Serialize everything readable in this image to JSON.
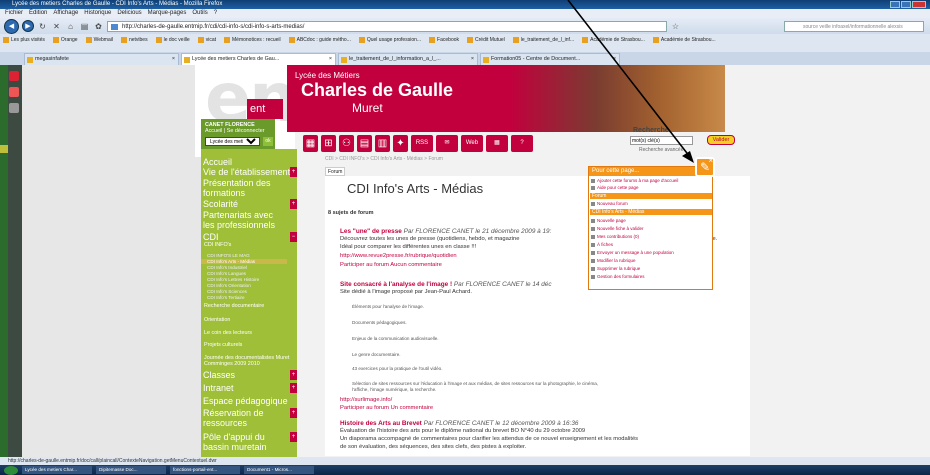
{
  "window": {
    "title": "Lycée des metiers Charles de Gaulle - CDI Info's Arts - Médias - Mozilla Firefox"
  },
  "menubar": [
    "Fichier",
    "Édition",
    "Affichage",
    "Historique",
    "Delicious",
    "Marque-pages",
    "Outils",
    "?"
  ],
  "url": "http://charles-de-gaulle.entmip.fr/cdi/cdi-info-s/cdi-info-s-arts-medias/",
  "search_placeholder": "source veille infoaxel/informationnelle alexsis",
  "bookmarks": [
    "Les plus visités",
    "Orange",
    "Webmail",
    "netvibes",
    "le doc veille",
    "vicat",
    "Mémonotices : recueil",
    "ABCdoc : guide métho...",
    "Quel usage profession...",
    "Facebook",
    "Crédit Mutuel",
    "le_traitement_de_l_inf...",
    "Académie de Strasbou...",
    "Académie de Strasbou..."
  ],
  "tabs": [
    {
      "label": "megasinfafete"
    },
    {
      "label": "Lycée des metiers Charles de Gau..."
    },
    {
      "label": "le_traitement_de_l_information_a_l_..."
    },
    {
      "label": "Formation05 - Centre de Document..."
    }
  ],
  "header": {
    "school_top": "Lycée des Métiers",
    "school": "Charles de Gaulle",
    "town": "Muret",
    "ent_tag": "ent",
    "ent_big": "ent"
  },
  "user": {
    "name": "CANET FLORENCE",
    "links": "Accueil | Se déconnecter",
    "select_value": "Lycée des metiers Charles",
    "ok": "ok"
  },
  "menu": {
    "accueil": "Accueil",
    "vie": "Vie de l'établissement",
    "presentation": "Présentation des formations",
    "scolarite": "Scolarité",
    "partenariats": "Partenariats avec les professionnels",
    "cdi": "CDI",
    "cdi_infos": "CDI INFO's",
    "subs": [
      "CDI INFO'S LE MAG",
      "CDI Info's Arts - Médias",
      "CDI Info's Industriel",
      "CDI Info's Langues",
      "CDI Info's Lettres Histoire",
      "CDI Info's Orientation",
      "CDI Info's Sciences",
      "CDI Info's Tertiaire"
    ],
    "recherche": "Recherche documentaire",
    "orientation": "Orientation",
    "coin": "Le coin des lecteurs",
    "projets": "Projets culturels",
    "journee": "Journée des documentalistes Muret Comminges 2009 2010",
    "classes": "Classes",
    "intranet": "Intranet",
    "espace": "Espace pédagogique",
    "reservation": "Réservation de ressources",
    "pole": "Pôle d'appui du bassin muretain"
  },
  "tool_texts": {
    "rss": "RSS",
    "web": "Web",
    "tv": "TV",
    "q": "?"
  },
  "recherche": {
    "label": "Recherche",
    "input": "mot(s) clé(s)",
    "go": "Valider",
    "adv": "Recherche avancée"
  },
  "breadcrumb": "CDI > CDI INFO's > CDI Info's Arts - Médias > Forum",
  "forum_tab": "Forum",
  "main_title": "CDI Info's Arts - Médias",
  "count": "8 sujets de forum",
  "topics": [
    {
      "title": "Les \"une\" de presse",
      "meta": "Par FLORENCE CANET le 21 décembre 2009 à 19:",
      "lines": [
        "Découvrez toutes les unes de presse (quotidiens, hebdo, et magazine",
        "Idéal pour comparer les différentes unes en classe !!!"
      ],
      "link": "http://www.revue2presse.fr/rubrique/quotidien",
      "actions": "Participer au forum   Aucun commentaire"
    },
    {
      "title": "Site consacré à l'analyse de l'image !",
      "meta": "Par FLORENCE CANET le 14 déc",
      "lines": [
        "Site dédié à l'image proposé par Jean-Paul Achard."
      ],
      "list": [
        "Éléments pour l'analyse de l'image.",
        "Documents pédagogiques.",
        "Enjeux de la communication audiovisuelle.",
        "Le genre documentaire.",
        "43 exercices pour la pratique de l'outil vidéo.",
        "Sélection de sites ressources sur l'éducation à l'image et aux médias, de sites ressources sur la photographie, le cinéma,",
        "l'affiche, l'image numérique, la recherche."
      ],
      "link": "http://surlimage.info/",
      "actions": "Participer au forum   Un commentaire"
    },
    {
      "title": "Histoire des Arts au Brevet",
      "meta": "Par FLORENCE CANET le 12 décembre 2009 à 16:36",
      "lines": [
        "Évaluation de l'histoire des arts pour le diplôme national du brevet BO N°40 du 29 octobre 2009",
        "Un diaporama accompagné de commentaires pour clarifier les attendus de ce nouvel enseignement et les modalités",
        "de son évaluation, des séquences, des sites clefs, des pistes à exploiter."
      ]
    }
  ],
  "trailing_text": "que.",
  "popup": {
    "header": "Pour cette page...",
    "page_rows": [
      "Ajouter cette forums à ma page d'accueil",
      "Aide pour cette page"
    ],
    "sec1": "Forum",
    "forum_rows": [
      "Nouveau forum"
    ],
    "sec2": "CDI Info's Arts - Médias",
    "cdi_rows": [
      "Nouvelle page",
      "Nouvelle fiche à valider",
      "Mes contributions (0)",
      "À fiches",
      "Envoyer un message à une population",
      "Modifier la rubrique",
      "Supprimer la rubrique",
      "Gestion des formulaires"
    ]
  },
  "status": "http://charles-de-gaulle.entmip.fr/doc/call/plaincall/ContexteNavigation.getMenuContextuel.dwr",
  "taskbar": [
    "Lycée des metiers Char...",
    "Dipitemasse Doc...",
    "fonctions-portail-ent...",
    "Document1 - Micros..."
  ],
  "colors": {
    "brand": "#c2003e",
    "menu": "#a0bf38",
    "popup": "#f59618"
  }
}
